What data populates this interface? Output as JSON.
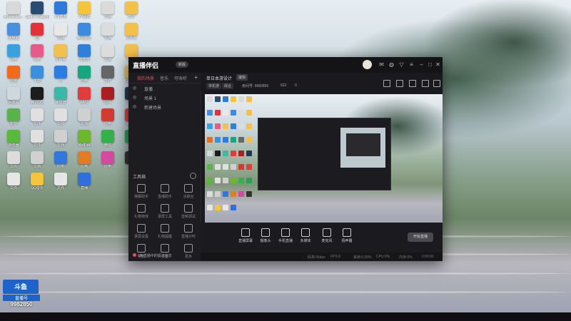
{
  "desktop": {
    "icons": [
      {
        "label": "Administra...",
        "color": "#d9d9d9"
      },
      {
        "label": "Steam Wallpaper",
        "color": "#2a4b74"
      },
      {
        "label": "XX开发",
        "color": "#2e7ad8"
      },
      {
        "label": "YY语音",
        "color": "#f4c53b"
      },
      {
        "label": "文档",
        "color": "#dadada"
      },
      {
        "label": "文件",
        "color": "#f2c14c"
      },
      {
        "label": "此电脑",
        "color": "#4a8fdc"
      },
      {
        "label": "逗",
        "color": "#e2333a"
      },
      {
        "label": "文档",
        "color": "#e8e8e8"
      },
      {
        "label": "腾讯会议",
        "color": "#3e8ae0"
      },
      {
        "label": "文档",
        "color": "#dcdcdc"
      },
      {
        "label": "文件夹",
        "color": "#f3c04c"
      },
      {
        "label": "网络",
        "color": "#3aa0e0"
      },
      {
        "label": "相册",
        "color": "#e85a8a"
      },
      {
        "label": "文件夹",
        "color": "#f3c04c"
      },
      {
        "label": "浏览器",
        "color": "#2f7fdb"
      },
      {
        "label": "文档",
        "color": "#dcdcdc"
      },
      {
        "label": "文件夹",
        "color": "#f3c04c"
      },
      {
        "label": "应用",
        "color": "#f26b1d"
      },
      {
        "label": "下载",
        "color": "#3b8fdd"
      },
      {
        "label": "K",
        "color": "#2c7de0"
      },
      {
        "label": "应用",
        "color": "#17a67d"
      },
      {
        "label": "文件",
        "color": "#666666"
      },
      {
        "label": "文件夹",
        "color": "#f3c04c"
      },
      {
        "label": "回收站",
        "color": "#cfd8dd"
      },
      {
        "label": "腾讯QQ",
        "color": "#1c1c1c"
      },
      {
        "label": "播放器",
        "color": "#3fb7a6"
      },
      {
        "label": "WPS",
        "color": "#e23b3b"
      },
      {
        "label": "图片",
        "color": "#aa1f1f"
      },
      {
        "label": "Steam",
        "color": "#23394f"
      },
      {
        "label": "影音",
        "color": "#5ab24b"
      },
      {
        "label": "文件",
        "color": "#e0e0e0"
      },
      {
        "label": "文件",
        "color": "#e0e0e0"
      },
      {
        "label": "文档",
        "color": "#d0d0d0"
      },
      {
        "label": "应用",
        "color": "#d33b2e"
      },
      {
        "label": "网易云",
        "color": "#e23c3c"
      },
      {
        "label": "浏览器",
        "color": "#58b93b"
      },
      {
        "label": "文件",
        "color": "#e0e0e0"
      },
      {
        "label": "文档",
        "color": "#d0d0d0"
      },
      {
        "label": "NVIDIA",
        "color": "#6cb82a"
      },
      {
        "label": "微信",
        "color": "#33b24a"
      },
      {
        "label": "应用",
        "color": "#20a455"
      },
      {
        "label": "文件",
        "color": "#dcdcdc"
      },
      {
        "label": "文档",
        "color": "#d0d0d0"
      },
      {
        "label": "应用",
        "color": "#3377dd"
      },
      {
        "label": "应用",
        "color": "#e07b28"
      },
      {
        "label": "应用",
        "color": "#d34aa0"
      },
      {
        "label": "应用",
        "color": "#333333"
      },
      {
        "label": "文件",
        "color": "#e6e6e6"
      },
      {
        "label": "QQ音乐",
        "color": "#f4c53b"
      },
      {
        "label": "文件",
        "color": "#e6e6e6"
      },
      {
        "label": "直播",
        "color": "#2f6fdb"
      }
    ],
    "brand": {
      "logo": "斗鱼",
      "sub": "直播号",
      "number": "9982850"
    }
  },
  "app": {
    "logo": "直播伴侣",
    "version_badge": "新版",
    "left": {
      "tabs": [
        "我的场景",
        "音乐",
        "可收听"
      ],
      "scenes": [
        "直播",
        "场景 1",
        "新建场景"
      ],
      "tools_title": "工具箱",
      "tools": [
        "弹幕助手",
        "直播助手",
        "点歌台",
        "礼物特效",
        "录屏工具",
        "音频调试",
        "录屏设置",
        "礼物提醒",
        "直播计时",
        "特效",
        "设置",
        "更多"
      ],
      "notice": "1条直播中的提示信息"
    },
    "topinfo": {
      "room_name": "单日本游设计",
      "edit": "编辑",
      "chips": [
        "单机游",
        "综合"
      ],
      "room_id_label": "房间号: 9982850",
      "hot": "622",
      "viewers": "0"
    },
    "bottom": {
      "buttons": [
        "直播屏幕",
        "摄像头",
        "手机直播",
        "多媒体",
        "麦克风",
        "扬声器"
      ],
      "start": "开始直播"
    },
    "status": [
      "码率:0kbps",
      "FPS:0",
      "丢帧:0.00%",
      "CPU:0%",
      "内存:0%",
      "0:00:00"
    ]
  }
}
